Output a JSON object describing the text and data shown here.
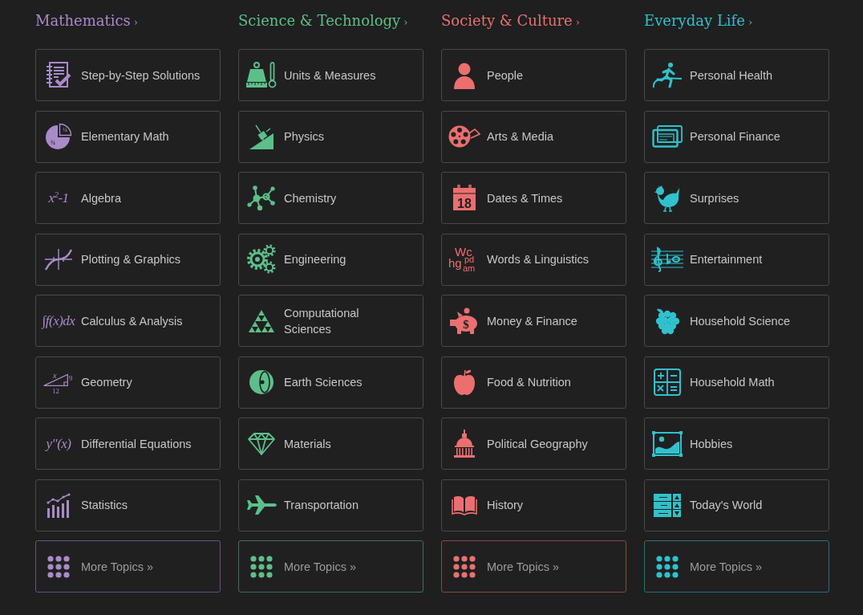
{
  "columns": [
    {
      "title": "Mathematics",
      "chevron": "›",
      "color": "#a98bc9",
      "items": [
        {
          "label": "Step-by-Step Solutions",
          "kind": "notepad"
        },
        {
          "label": "Elementary Math",
          "kind": "pie",
          "icon_labels": [
            "¼",
            "¾"
          ]
        },
        {
          "label": "Algebra",
          "kind": "formula",
          "icon_text": "x$^{2}$-1"
        },
        {
          "label": "Plotting & Graphics",
          "kind": "graph"
        },
        {
          "label": "Calculus & Analysis",
          "kind": "formula",
          "icon_text": "∫f(x)dx"
        },
        {
          "label": "Geometry",
          "kind": "triangle",
          "icon_labels": [
            "x",
            "9",
            "12"
          ]
        },
        {
          "label": "Differential Equations",
          "kind": "formula",
          "icon_text": "y″(x)"
        },
        {
          "label": "Statistics",
          "kind": "bars"
        }
      ],
      "more": "More Topics »"
    },
    {
      "title": "Science & Technology",
      "chevron": "›",
      "color": "#5cbf8a",
      "items": [
        {
          "label": "Units & Measures",
          "kind": "weight"
        },
        {
          "label": "Physics",
          "kind": "incline"
        },
        {
          "label": "Chemistry",
          "kind": "molecule"
        },
        {
          "label": "Engineering",
          "kind": "gears"
        },
        {
          "label": "Computational Sciences",
          "kind": "sierpinski"
        },
        {
          "label": "Earth Sciences",
          "kind": "globe"
        },
        {
          "label": "Materials",
          "kind": "diamond"
        },
        {
          "label": "Transportation",
          "kind": "airplane"
        }
      ],
      "more": "More Topics »"
    },
    {
      "title": "Society & Culture",
      "chevron": "›",
      "color": "#ec6f6f",
      "items": [
        {
          "label": "People",
          "kind": "bust"
        },
        {
          "label": "Arts & Media",
          "kind": "reel"
        },
        {
          "label": "Dates & Times",
          "kind": "calendar",
          "icon_labels": [
            "18"
          ]
        },
        {
          "label": "Words & Linguistics",
          "kind": "letters",
          "icon_labels": [
            "Wc",
            "hg",
            "pd",
            "am"
          ]
        },
        {
          "label": "Money & Finance",
          "kind": "piggy",
          "icon_labels": [
            "$"
          ]
        },
        {
          "label": "Food & Nutrition",
          "kind": "apple"
        },
        {
          "label": "Political Geography",
          "kind": "dome"
        },
        {
          "label": "History",
          "kind": "book"
        }
      ],
      "more": "More Topics »"
    },
    {
      "title": "Everyday Life",
      "chevron": "›",
      "color": "#2fc2cc",
      "items": [
        {
          "label": "Personal Health",
          "kind": "runner"
        },
        {
          "label": "Personal Finance",
          "kind": "card"
        },
        {
          "label": "Surprises",
          "kind": "hen"
        },
        {
          "label": "Entertainment",
          "kind": "staff"
        },
        {
          "label": "Household Science",
          "kind": "grapes"
        },
        {
          "label": "Household Math",
          "kind": "calculator"
        },
        {
          "label": "Hobbies",
          "kind": "picture"
        },
        {
          "label": "Today's World",
          "kind": "ticker"
        }
      ],
      "more": "More Topics »"
    }
  ]
}
